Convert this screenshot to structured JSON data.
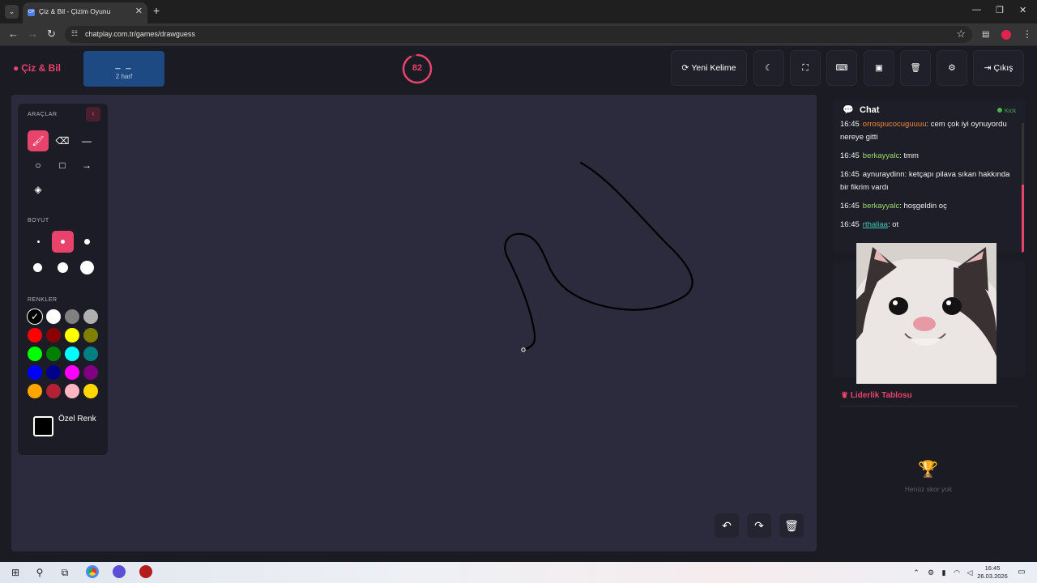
{
  "browser": {
    "tab_title": "Çiz & Bil - Çizim Oyunu",
    "tab_favicon": "CP",
    "url": "chatplay.com.tr/games/drawguess"
  },
  "header": {
    "logo_text": "Çiz & Bil",
    "word_blanks": "_ _",
    "word_hint": "2 harf",
    "timer_value": "82",
    "timer_progress": 0.92,
    "buttons": {
      "new_word": "Yeni Kelime",
      "exit": "Çıkış"
    }
  },
  "tools": {
    "title": "ARAÇLAR",
    "size_title": "BOYUT",
    "colors_title": "RENKLER",
    "custom_color_label": "Özel Renk",
    "active_tool": "brush",
    "active_size_index": 1,
    "selected_color": "#000000",
    "colors": [
      "#000000",
      "#ffffff",
      "#808080",
      "#b0b0b0",
      "#ff0000",
      "#8b0000",
      "#ffff00",
      "#808000",
      "#00ff00",
      "#008000",
      "#00ffff",
      "#008080",
      "#0000ff",
      "#00008b",
      "#ff00ff",
      "#800080",
      "#ffa500",
      "#b22234",
      "#ffb6c1",
      "#ffd700"
    ]
  },
  "chat": {
    "title": "Chat",
    "kick_label": "Kick",
    "messages": [
      {
        "time": "16:45",
        "user": "orrospucocuguuuu",
        "text": "cem çok iyi oynuyordu nereye gitti",
        "color": "orange"
      },
      {
        "time": "16:45",
        "user": "berkayyalc",
        "text": "tmm",
        "color": "green"
      },
      {
        "time": "16:45",
        "user": "aynuraydinn",
        "text": "ketçapı pilava sıkan hakkında bir fikrim vardı",
        "color": "plain"
      },
      {
        "time": "16:45",
        "user": "berkayyalc",
        "text": "hoşgeldin oç",
        "color": "green"
      },
      {
        "time": "16:45",
        "user": "rthaliaa",
        "text": "ot",
        "color": "teal"
      }
    ]
  },
  "leaderboard": {
    "title": "Liderlik Tablosu",
    "empty_text": "Henüz skor yok"
  },
  "taskbar": {
    "time": "16:45",
    "date": "26.03.2026"
  },
  "accent_color": "#e8436a"
}
